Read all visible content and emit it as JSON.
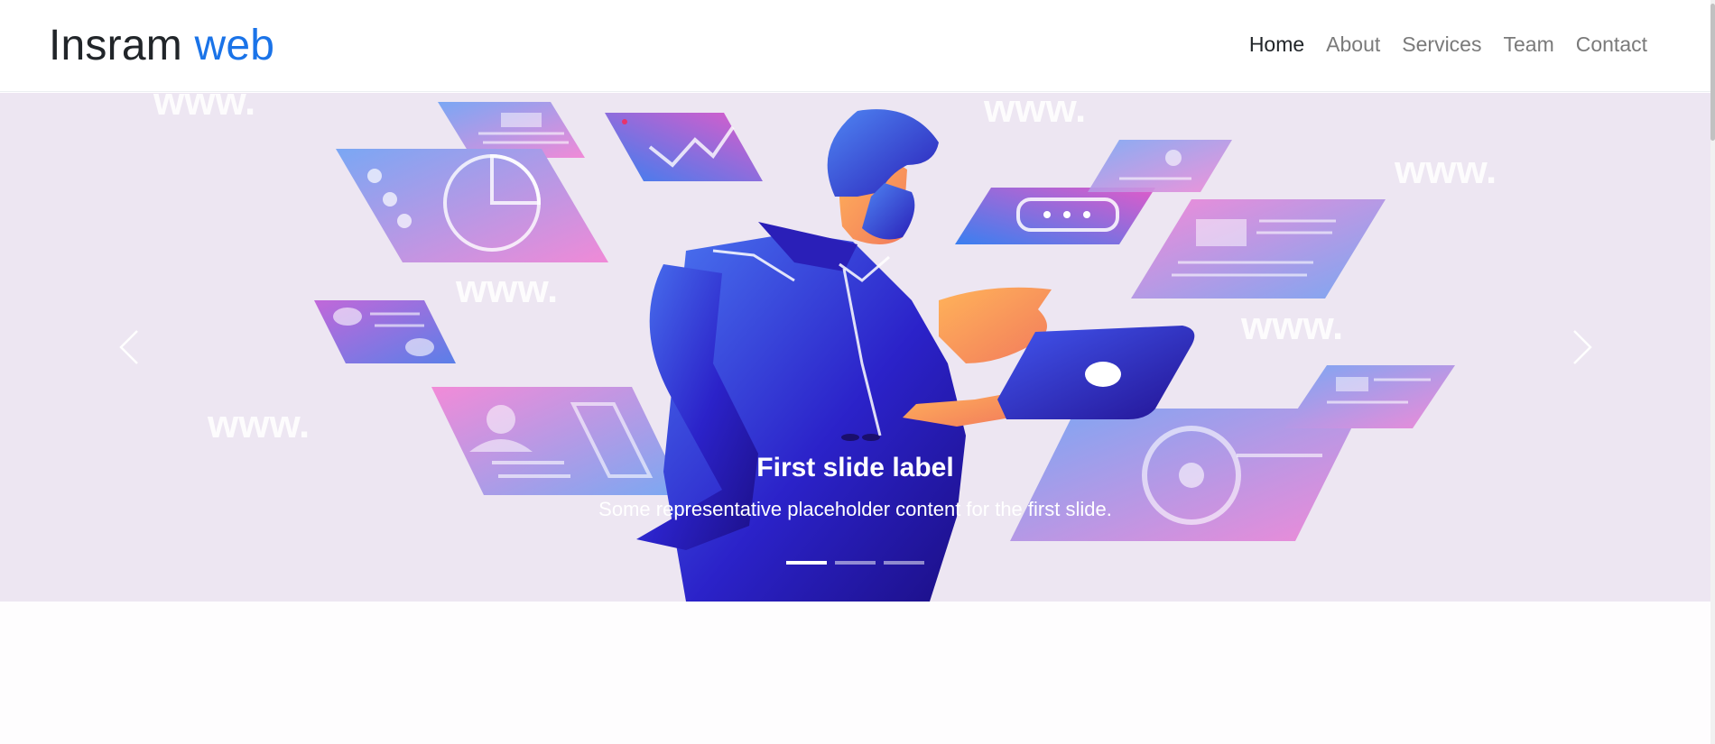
{
  "brand": {
    "name": "Insram",
    "accent": "web",
    "accent_color": "#1a73e8"
  },
  "nav": {
    "items": [
      {
        "label": "Home",
        "active": true
      },
      {
        "label": "About",
        "active": false
      },
      {
        "label": "Services",
        "active": false
      },
      {
        "label": "Team",
        "active": false
      },
      {
        "label": "Contact",
        "active": false
      }
    ]
  },
  "carousel": {
    "background": "#ede6f2",
    "slide": {
      "title": "First slide label",
      "text": "Some representative placeholder content for the first slide.",
      "watermark": "www."
    },
    "indicator_count": 3,
    "active_index": 0,
    "prev_icon": "chevron-left-icon",
    "next_icon": "chevron-right-icon"
  }
}
